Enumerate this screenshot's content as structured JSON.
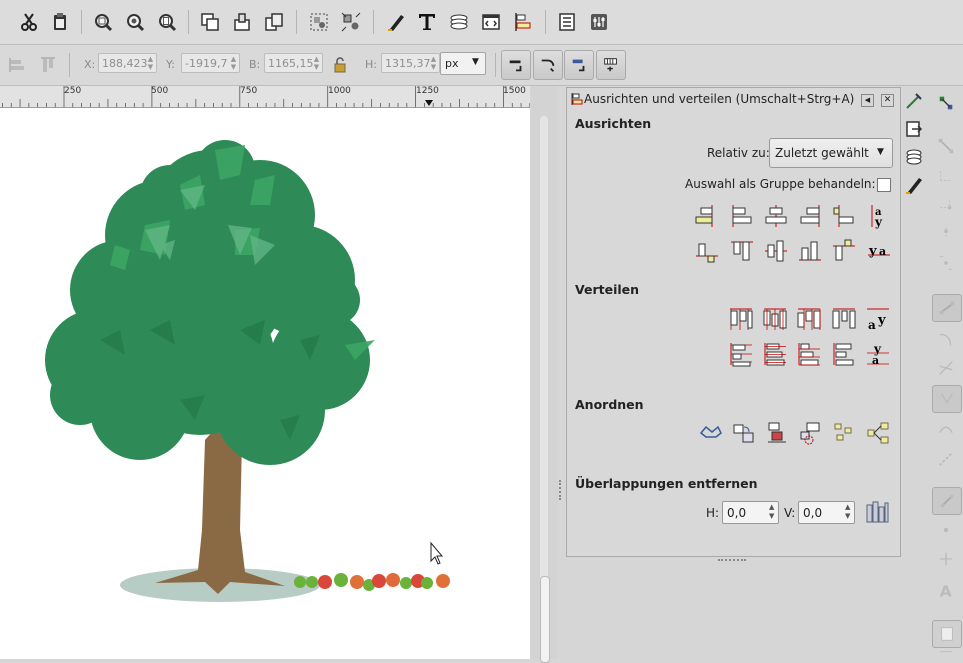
{
  "toolbar": {
    "icons": [
      "cut-icon",
      "paste-icon",
      "zoom-selection-icon",
      "zoom-drawing-icon",
      "zoom-page-icon",
      "duplicate-icon",
      "clone-icon",
      "unlink-clone-icon",
      "group-icon",
      "ungroup-icon",
      "fill-stroke-icon",
      "text-tool-icon",
      "layers-icon",
      "xml-editor-icon",
      "align-distribute-icon",
      "preferences-icon",
      "document-properties-icon"
    ]
  },
  "controls": {
    "x_label": "X:",
    "x_value": "188,423",
    "y_label": "Y:",
    "y_value": "-1919,7",
    "w_label": "B:",
    "w_value": "1165,15",
    "h_label": "H:",
    "h_value": "1315,37",
    "unit": "px"
  },
  "ruler": {
    "ticks": [
      "250",
      "500",
      "750",
      "1000",
      "1250",
      "1500"
    ]
  },
  "dialog": {
    "title": "Ausrichten und verteilen (Umschalt+Strg+A)",
    "align": {
      "heading": "Ausrichten",
      "relative_label": "Relativ zu:",
      "relative_value": "Zuletzt gewählt",
      "group_label": "Auswahl als Gruppe behandeln:",
      "group_checked": false
    },
    "distribute": {
      "heading": "Verteilen"
    },
    "arrange": {
      "heading": "Anordnen"
    },
    "overlap": {
      "heading": "Überlappungen entfernen",
      "h_label": "H:",
      "h_value": "0,0",
      "v_label": "V:",
      "v_value": "0,0"
    }
  },
  "colors": {
    "canvas": "#ffffff",
    "tree_dark": "#2e8b57",
    "tree_light": "#3ca564",
    "trunk": "#8a6a45",
    "shadow": "#b7ccc4",
    "apple_red": "#d9473a",
    "apple_green": "#6ab23a",
    "guide_red": "#cc0000"
  }
}
